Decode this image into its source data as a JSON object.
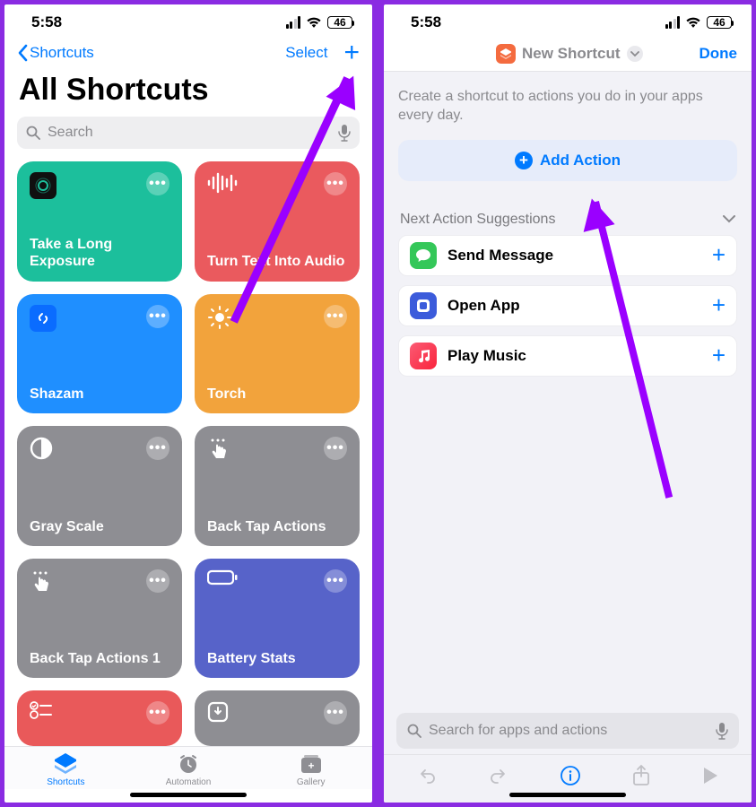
{
  "status": {
    "time": "5:58",
    "battery": "46"
  },
  "left": {
    "back": "Shortcuts",
    "select": "Select",
    "title": "All Shortcuts",
    "search_placeholder": "Search",
    "tiles": [
      {
        "title": "Take a Long Exposure",
        "color": "#1cbf9c"
      },
      {
        "title": "Turn Text Into Audio",
        "color": "#ea5a5e"
      },
      {
        "title": "Shazam",
        "color": "#1f8fff"
      },
      {
        "title": "Torch",
        "color": "#f2a33c"
      },
      {
        "title": "Gray Scale",
        "color": "#8e8e93"
      },
      {
        "title": "Back Tap Actions",
        "color": "#8e8e93"
      },
      {
        "title": "Back Tap Actions 1",
        "color": "#8e8e93"
      },
      {
        "title": "Battery Stats",
        "color": "#5763c9"
      },
      {
        "title": "",
        "color": "#e9595a"
      },
      {
        "title": "",
        "color": "#8e8e93"
      }
    ],
    "tabs": {
      "shortcuts": "Shortcuts",
      "automation": "Automation",
      "gallery": "Gallery"
    }
  },
  "right": {
    "title": "New Shortcut",
    "done": "Done",
    "desc": "Create a shortcut to actions you do in your apps every day.",
    "add_action": "Add Action",
    "next_heading": "Next Action Suggestions",
    "suggestions": [
      {
        "label": "Send Message",
        "color": "#34c759"
      },
      {
        "label": "Open App",
        "color": "#3b5bdb"
      },
      {
        "label": "Play Music",
        "color": "#fc3158"
      }
    ],
    "search_placeholder": "Search for apps and actions"
  }
}
